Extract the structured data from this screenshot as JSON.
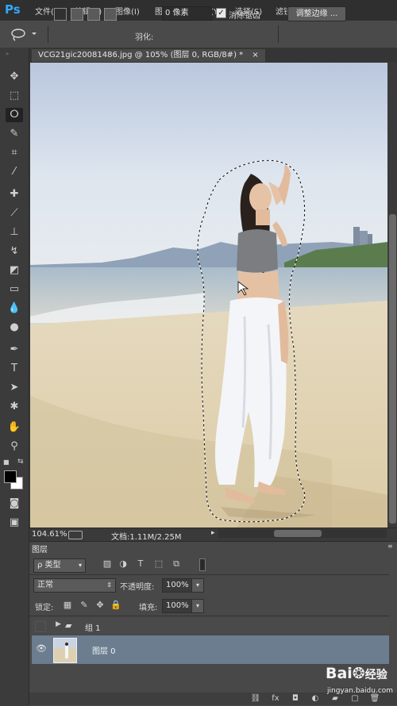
{
  "app": {
    "logo": "Ps"
  },
  "menu": [
    "文件(F)",
    "编辑(E)",
    "图像(I)",
    "图层(L)",
    "类型(Y)",
    "选择(S)",
    "滤镜(T)"
  ],
  "options": {
    "feather_label": "羽化:",
    "feather_value": "0 像素",
    "antialias_checked": true,
    "antialias_label": "消除锯齿",
    "refine_edge_label": "调整边缘 ..."
  },
  "document": {
    "tab_title": "VCG21gic20081486.jpg @ 105% (图层 0, RGB/8#) *",
    "close_glyph": "×"
  },
  "status": {
    "zoom": "104.61%",
    "doc_size": "文档:1.11M/2.25M"
  },
  "layers_panel": {
    "tab_label": "图层",
    "filter_label": "ρ 类型",
    "blend_mode": "正常",
    "opacity_label": "不透明度:",
    "opacity_value": "100%",
    "lock_label": "锁定:",
    "fill_label": "填充:",
    "fill_value": "100%",
    "layers": [
      {
        "name": "组 1",
        "type": "group",
        "visible": false
      },
      {
        "name": "图层 0",
        "type": "pixel",
        "visible": true,
        "selected": true
      }
    ]
  },
  "watermark": {
    "brand": "Bai",
    "brand_suffix": "经验",
    "url": "jingyan.baidu.com"
  },
  "colors": {
    "foreground": "#000000",
    "background": "#ffffff",
    "selected_layer": "#6b7d8f",
    "ps_blue": "#31a8ff"
  }
}
